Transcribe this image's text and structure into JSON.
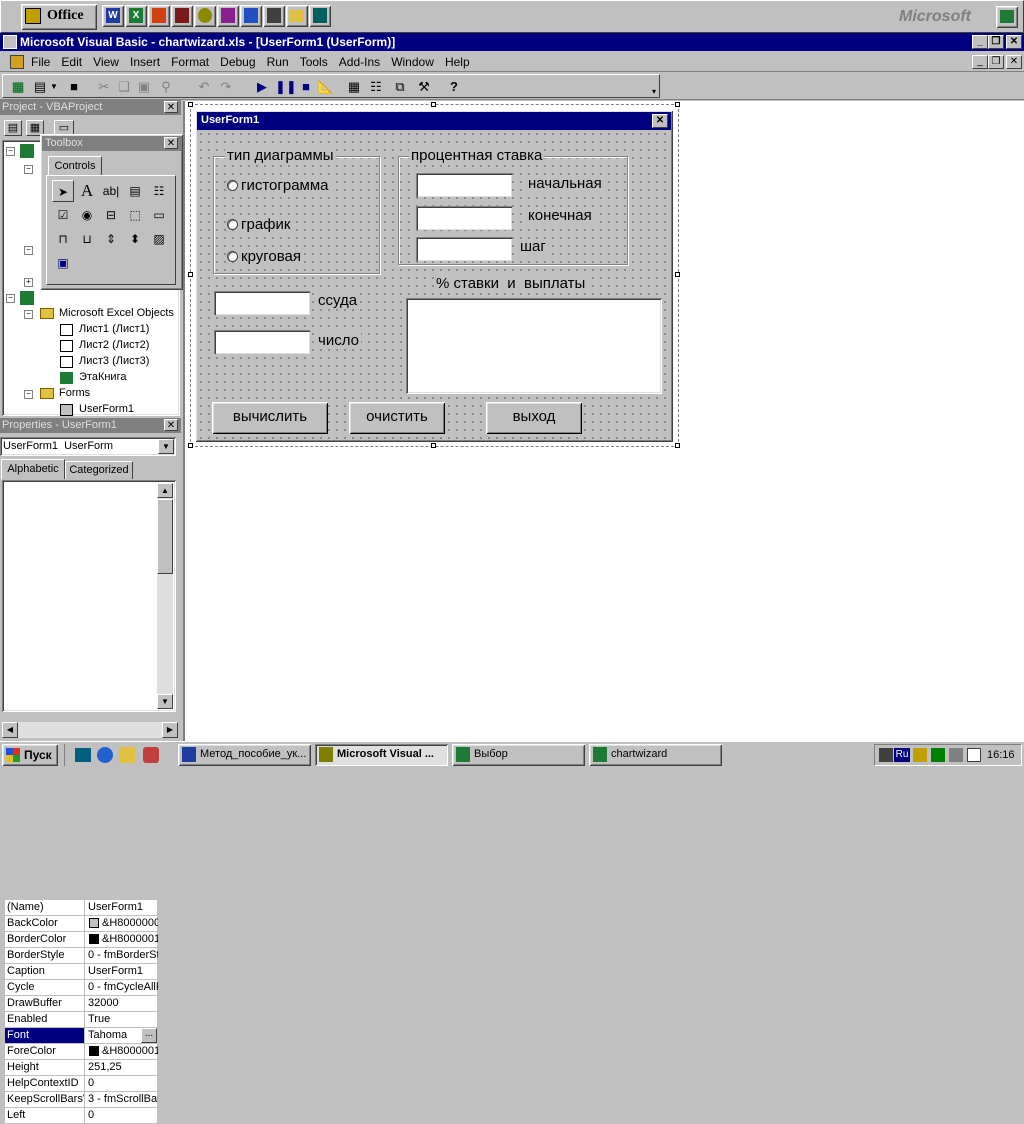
{
  "office_bar": {
    "label": "Office",
    "brand": "Microsoft"
  },
  "window": {
    "title": "Microsoft Visual Basic - chartwizard.xls - [UserForm1 (UserForm)]"
  },
  "menu": [
    "File",
    "Edit",
    "View",
    "Insert",
    "Format",
    "Debug",
    "Run",
    "Tools",
    "Add-Ins",
    "Window",
    "Help"
  ],
  "project_panel": {
    "title": "Project - VBAProject",
    "items": [
      "Microsoft Excel Objects",
      "Лист1 (Лист1)",
      "Лист2 (Лист2)",
      "Лист3 (Лист3)",
      "ЭтаКнига",
      "Forms",
      "UserForm1"
    ]
  },
  "toolbox": {
    "title": "Toolbox",
    "tab": "Controls"
  },
  "properties": {
    "title": "Properties - UserForm1",
    "object": "UserForm1  UserForm",
    "tab_alpha": "Alphabetic",
    "tab_cat": "Categorized",
    "rows": [
      {
        "k": "(Name)",
        "v": "UserForm1"
      },
      {
        "k": "BackColor",
        "v": "&H8000000"
      },
      {
        "k": "BorderColor",
        "v": "&H8000001"
      },
      {
        "k": "BorderStyle",
        "v": "0 - fmBorderSt"
      },
      {
        "k": "Caption",
        "v": "UserForm1"
      },
      {
        "k": "Cycle",
        "v": "0 - fmCycleAllF"
      },
      {
        "k": "DrawBuffer",
        "v": "32000"
      },
      {
        "k": "Enabled",
        "v": "True"
      },
      {
        "k": "Font",
        "v": "Tahoma"
      },
      {
        "k": "ForeColor",
        "v": "&H8000001"
      },
      {
        "k": "Height",
        "v": "251,25"
      },
      {
        "k": "HelpContextID",
        "v": "0"
      },
      {
        "k": "KeepScrollBarsVi",
        "v": "3 - fmScrollBar"
      },
      {
        "k": "Left",
        "v": "0"
      }
    ]
  },
  "userform": {
    "title": "UserForm1",
    "chart_type_frame": "тип диаграммы",
    "radio1": "гистограмма",
    "radio2": "график",
    "radio3": "круговая",
    "rate_frame": "процентная ставка",
    "rate_start": "начальная",
    "rate_end": "конечная",
    "rate_step": "шаг",
    "loan": "ссуда",
    "number": "число",
    "list_label": "% ставки  и  выплаты",
    "btn_calc": "вычислить",
    "btn_clear": "очистить",
    "btn_exit": "выход"
  },
  "taskbar": {
    "start": "Пуск",
    "tasks": [
      "Метод_пособие_ук...",
      "Microsoft Visual ...",
      "Выбор",
      "chartwizard"
    ],
    "lang": "Ru",
    "clock": "16:16"
  },
  "colors": {
    "titlebar": "#000080",
    "desktop": "#c0c0c0",
    "selection": "#000080"
  }
}
